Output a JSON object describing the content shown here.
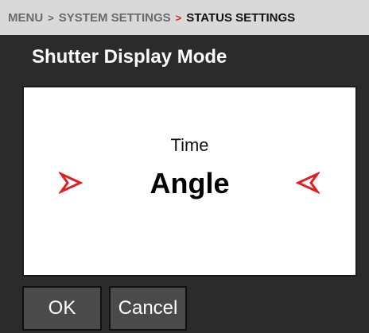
{
  "breadcrumb": {
    "items": [
      "MENU",
      "SYSTEM SETTINGS",
      "STATUS SETTINGS"
    ],
    "separator": ">"
  },
  "title": "Shutter Display Mode",
  "picker": {
    "options": [
      "Time",
      "Angle"
    ],
    "selected": "Angle",
    "arrow_color": "#e0201e"
  },
  "buttons": {
    "ok": "OK",
    "cancel": "Cancel"
  },
  "colors": {
    "accent_red": "#e0201e",
    "background": "#2b2b2b",
    "breadcrumb_bg": "#d9d9d9",
    "button_bg": "#4a4a4a"
  }
}
